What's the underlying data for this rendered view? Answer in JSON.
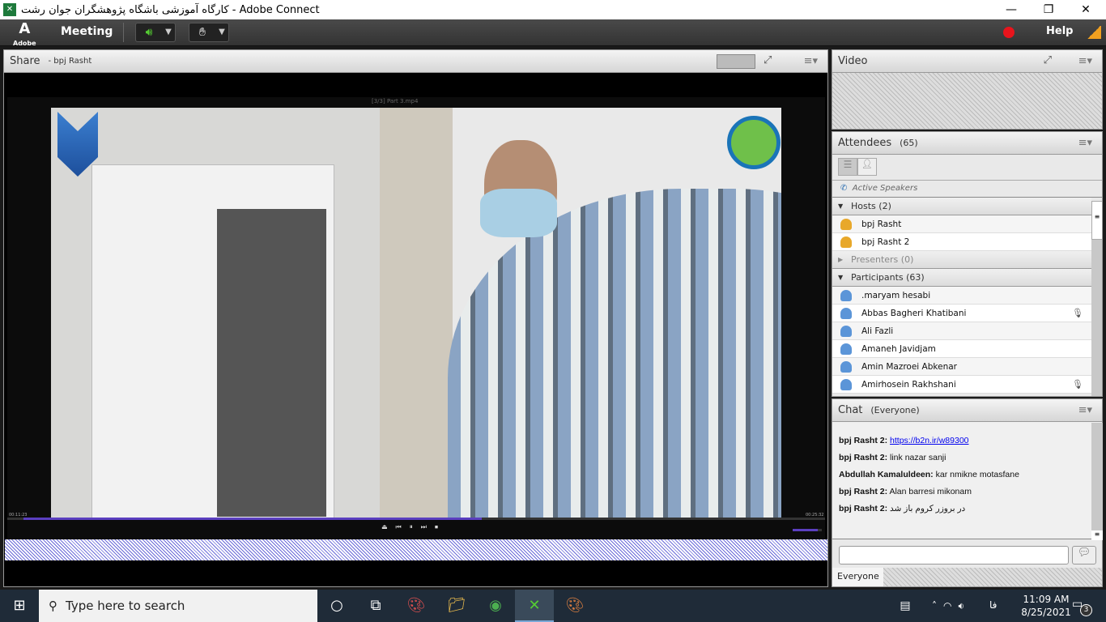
{
  "window": {
    "title": "کارگاه آموزشی باشگاه پژوهشگران جوان رشت - Adobe Connect",
    "minimize": "—",
    "maximize": "❐",
    "close": "✕"
  },
  "menubar": {
    "logo": "A",
    "logo_text": "Adobe",
    "meeting": "Meeting",
    "help": "Help",
    "recording_color": "#e8141c"
  },
  "share": {
    "title": "Share",
    "presenter": "- bpj Rasht",
    "player": {
      "elapsed": "00:11:23",
      "total": "00:25:32",
      "progress": 0.56,
      "volume": 0.85,
      "file_label": "[3/3] Part 3.mp4"
    }
  },
  "video_pod": {
    "title": "Video"
  },
  "attendees": {
    "title": "Attendees",
    "count": "(65)",
    "active_speakers": "Active Speakers",
    "hosts": {
      "label": "Hosts (2)",
      "items": [
        "bpj Rasht",
        "bpj Rasht 2"
      ]
    },
    "presenters": {
      "label": "Presenters (0)"
    },
    "participants": {
      "label": "Participants (63)",
      "items": [
        {
          "name": ".maryam hesabi",
          "mic": false,
          "mobile": true
        },
        {
          "name": "Abbas Bagheri Khatibani",
          "mic": true,
          "mobile": false
        },
        {
          "name": "Ali Fazli",
          "mic": false,
          "mobile": false
        },
        {
          "name": "Amaneh Javidjam",
          "mic": false,
          "mobile": false
        },
        {
          "name": "Amin Mazroei Abkenar",
          "mic": false,
          "mobile": true
        },
        {
          "name": "Amirhosein Rakhshani",
          "mic": true,
          "mobile": false
        }
      ]
    }
  },
  "chat": {
    "title": "Chat",
    "scope": "(Everyone)",
    "messages": [
      {
        "sender": "bpj Rasht 2:",
        "text": "https://b2n.ir/w89300",
        "link": true
      },
      {
        "sender": "bpj Rasht 2:",
        "text": "link nazar sanji",
        "link": false
      },
      {
        "sender": "Abdullah Kamaluldeen:",
        "text": "kar nmikne motasfane",
        "link": false
      },
      {
        "sender": "bpj Rasht 2:",
        "text": "Alan barresi mikonam",
        "link": false
      },
      {
        "sender": "bpj Rasht 2:",
        "text": "در بروزر کروم باز شد",
        "link": false
      }
    ],
    "input_value": "",
    "tab": "Everyone"
  },
  "taskbar": {
    "search_placeholder": "Type here to search",
    "time": "11:09 AM",
    "date": "8/25/2021",
    "lang": "فا",
    "notifications": "3"
  }
}
